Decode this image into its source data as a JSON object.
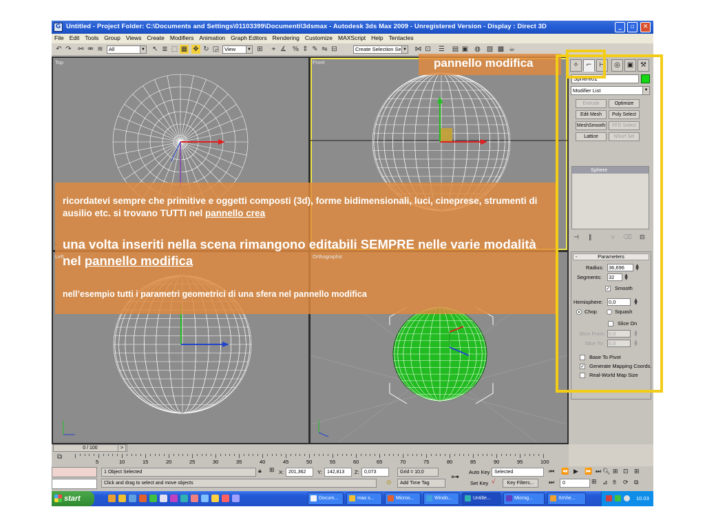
{
  "window": {
    "title": "Untitled    - Project Folder: C:\\Documents and Settings\\01103399\\Documenti\\3dsmax    - Autodesk 3ds Max  2009  - Unregistered Version    - Display : Direct 3D",
    "buttons": [
      "_",
      "▫",
      "✕"
    ]
  },
  "menu": [
    "File",
    "Edit",
    "Tools",
    "Group",
    "Views",
    "Create",
    "Modifiers",
    "Animation",
    "Graph Editors",
    "Rendering",
    "Customize",
    "MAXScript",
    "Help",
    "Tentacles"
  ],
  "toolbar": {
    "filter_value": "All",
    "refcoord_value": "View",
    "selection_set_placeholder": "Create Selection Set"
  },
  "viewports": {
    "top": "Top",
    "front": "Front",
    "left": "Left",
    "perspective": "Orthographic"
  },
  "command_panel": {
    "object_name": "Sphere01",
    "object_color": "#15d815",
    "modifier_list": "Modifier List",
    "modifier_buttons": [
      {
        "label": "Extrude",
        "enabled": false
      },
      {
        "label": "Optimize",
        "enabled": true
      },
      {
        "label": "Edit Mesh",
        "enabled": true
      },
      {
        "label": "Poly Select",
        "enabled": true
      },
      {
        "label": "MeshSmooth",
        "enabled": true
      },
      {
        "label": "FFD Select",
        "enabled": false
      },
      {
        "label": "Lattice",
        "enabled": true
      },
      {
        "label": "NSurf Sel",
        "enabled": false
      }
    ],
    "stack_item": "Sphere",
    "params": {
      "rollout_title": "Parameters",
      "radius_label": "Radius:",
      "radius_value": "36,696",
      "segments_label": "Segments:",
      "segments_value": "32",
      "smooth_label": "Smooth",
      "smooth_checked": true,
      "hemisphere_label": "Hemisphere:",
      "hemisphere_value": "0,0",
      "chop_label": "Chop",
      "squash_label": "Squash",
      "chop_selected": true,
      "slice_on_label": "Slice On",
      "slice_from_label": "Slice From:",
      "slice_from_value": "0,0",
      "slice_to_label": "Slice To:",
      "slice_to_value": "0,0",
      "base_to_pivot_label": "Base To Pivot",
      "gen_mapping_label": "Generate Mapping Coords.",
      "gen_mapping_checked": true,
      "realworld_label": "Real-World Map Size"
    }
  },
  "timeline": {
    "slider_text": "0 / 100",
    "slider_arrow": ">",
    "ticks": [
      "5",
      "10",
      "15",
      "20",
      "25",
      "30",
      "35",
      "40",
      "45",
      "50",
      "55",
      "60",
      "65",
      "70",
      "75",
      "80",
      "85",
      "90",
      "95",
      "100"
    ]
  },
  "status": {
    "selected": "1 Object Selected",
    "prompt": "Click and drag to select and move objects",
    "x_label": "X:",
    "x_value": "201,362",
    "y_label": "Y:",
    "y_value": "142,813",
    "z_label": "Z:",
    "z_value": "0,073",
    "grid": "Grid = 10,0",
    "add_time_tag": "Add Time Tag",
    "auto_key": "Auto Key",
    "selected_dropdown": "Selected",
    "set_key": "Set Key",
    "key_filters": "Key Filters...",
    "frame_value": "0"
  },
  "taskbar": {
    "start": "start",
    "tasks": [
      "Docum...",
      "max s...",
      "Micros...",
      "Windo...",
      "Untitle...",
      "Microg...",
      "XnVie..."
    ],
    "active_task": 4,
    "clock": "10.03"
  },
  "overlay": {
    "panel_label": "pannello modifica",
    "line1_pre": "ricordatevi sempre che primitive e oggetti composti (3d), forme bidimensionali, luci, cineprese, strumenti di ausilio etc. si trovano TUTTI nel ",
    "line1_link": "pannello crea",
    "line2_pre": "una volta inseriti nella scena rimangono editabili SEMPRE nelle varie modalità nel ",
    "line2_link": "pannello modifica",
    "line3": "nell’esempio tutti i parametri geometrici di una sfera nel pannello modifica"
  }
}
